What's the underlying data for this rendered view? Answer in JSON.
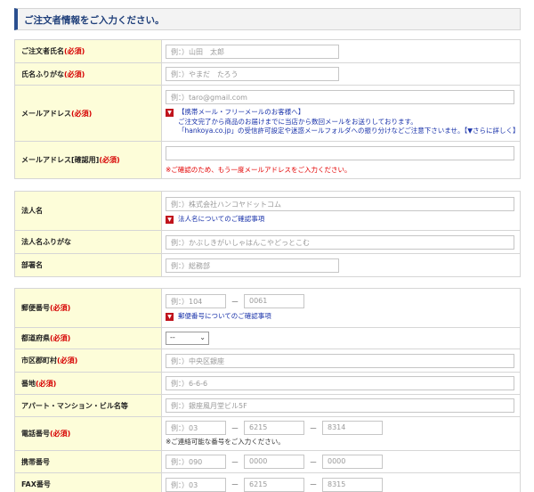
{
  "header": {
    "title": "ご注文者情報をご入力ください。"
  },
  "required_mark": "(必須)",
  "section1": {
    "name": {
      "label": "ご注文者氏名",
      "placeholder": "例：）山田　太郎"
    },
    "kana": {
      "label": "氏名ふりがな",
      "placeholder": "例：）やまだ　たろう"
    },
    "email": {
      "label": "メールアドレス",
      "placeholder": "例：）taro@gmail.com",
      "note_line1": "【携帯メール・フリーメールのお客様へ】",
      "note_line2": "ご注文完了から商品のお届けまでに当店から数回メールをお送りしております。",
      "note_line3": "「hankoya.co.jp」の受信許可設定や迷惑メールフォルダへの振り分けなどご注意下さいませ。【▼さらに詳しく】"
    },
    "email_confirm": {
      "label": "メールアドレス[確認用]",
      "placeholder": "",
      "warning": "※ご確認のため、もう一度メールアドレスをご入力ください。"
    }
  },
  "section2": {
    "corp": {
      "label": "法人名",
      "placeholder": "例：）株式会社ハンコヤドットコム",
      "note": "法人名についてのご確認事項"
    },
    "corp_kana": {
      "label": "法人名ふりがな",
      "placeholder": "例：）かぶしきがいしゃはんこやどっとこむ"
    },
    "dept": {
      "label": "部署名",
      "placeholder": "例：）総務部"
    }
  },
  "section3": {
    "zip": {
      "label": "郵便番号",
      "placeholder1": "例：）104",
      "placeholder2": "0061",
      "note": "郵便番号についてのご確認事項"
    },
    "pref": {
      "label": "都道府県",
      "selected": "--"
    },
    "city": {
      "label": "市区郡町村",
      "placeholder": "例：）中央区銀座"
    },
    "street": {
      "label": "番地",
      "placeholder": "例：）6-6-6"
    },
    "building": {
      "label": "アパート・マンション・ビル名等",
      "placeholder": "例：）銀座風月堂ビル5F"
    },
    "tel": {
      "label": "電話番号",
      "p1": "例：）03",
      "p2": "6215",
      "p3": "8314",
      "sub": "※ご連絡可能な番号をご入力ください。"
    },
    "mobile": {
      "label": "携帯番号",
      "p1": "例：）090",
      "p2": "0000",
      "p3": "0000"
    },
    "fax": {
      "label": "FAX番号",
      "p1": "例：）03",
      "p2": "6215",
      "p3": "8315"
    }
  },
  "icons": {
    "note_icon": "triangle-down-icon",
    "select_arrow": "chevron-down-icon"
  },
  "colors": {
    "accent": "#2a4f8f",
    "label_bg": "#fdfdd9",
    "required": "#d60000",
    "note": "#1a33aa"
  }
}
